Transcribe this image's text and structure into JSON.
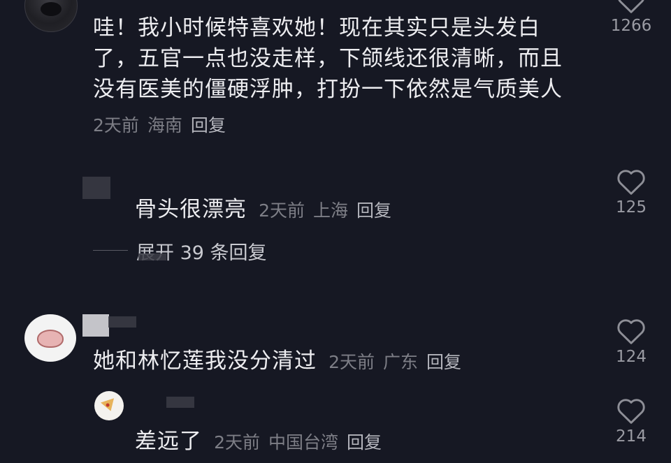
{
  "comments": [
    {
      "text": "哇！我小时候特喜欢她！现在其实只是头发白了，五官一点也没走样，下颌线还很清晰，而且没有医美的僵硬浮肿，打扮一下依然是气质美人",
      "time": "2天前",
      "location": "海南",
      "reply_label": "回复",
      "likes": "1266"
    },
    {
      "text": "骨头很漂亮",
      "time": "2天前",
      "location": "上海",
      "reply_label": "回复",
      "likes": "125"
    },
    {
      "text": "她和林忆莲我没分清过",
      "time": "2天前",
      "location": "广东",
      "reply_label": "回复",
      "likes": "124"
    },
    {
      "text": "差远了",
      "time": "2天前",
      "location": "中国台湾",
      "reply_label": "回复",
      "likes": "214"
    }
  ],
  "expand_replies": "展开 39 条回复",
  "icons": {
    "like": "heart-outline-icon"
  },
  "colors": {
    "background": "#161823",
    "text": "#ededf0",
    "meta": "#7d7e86"
  }
}
